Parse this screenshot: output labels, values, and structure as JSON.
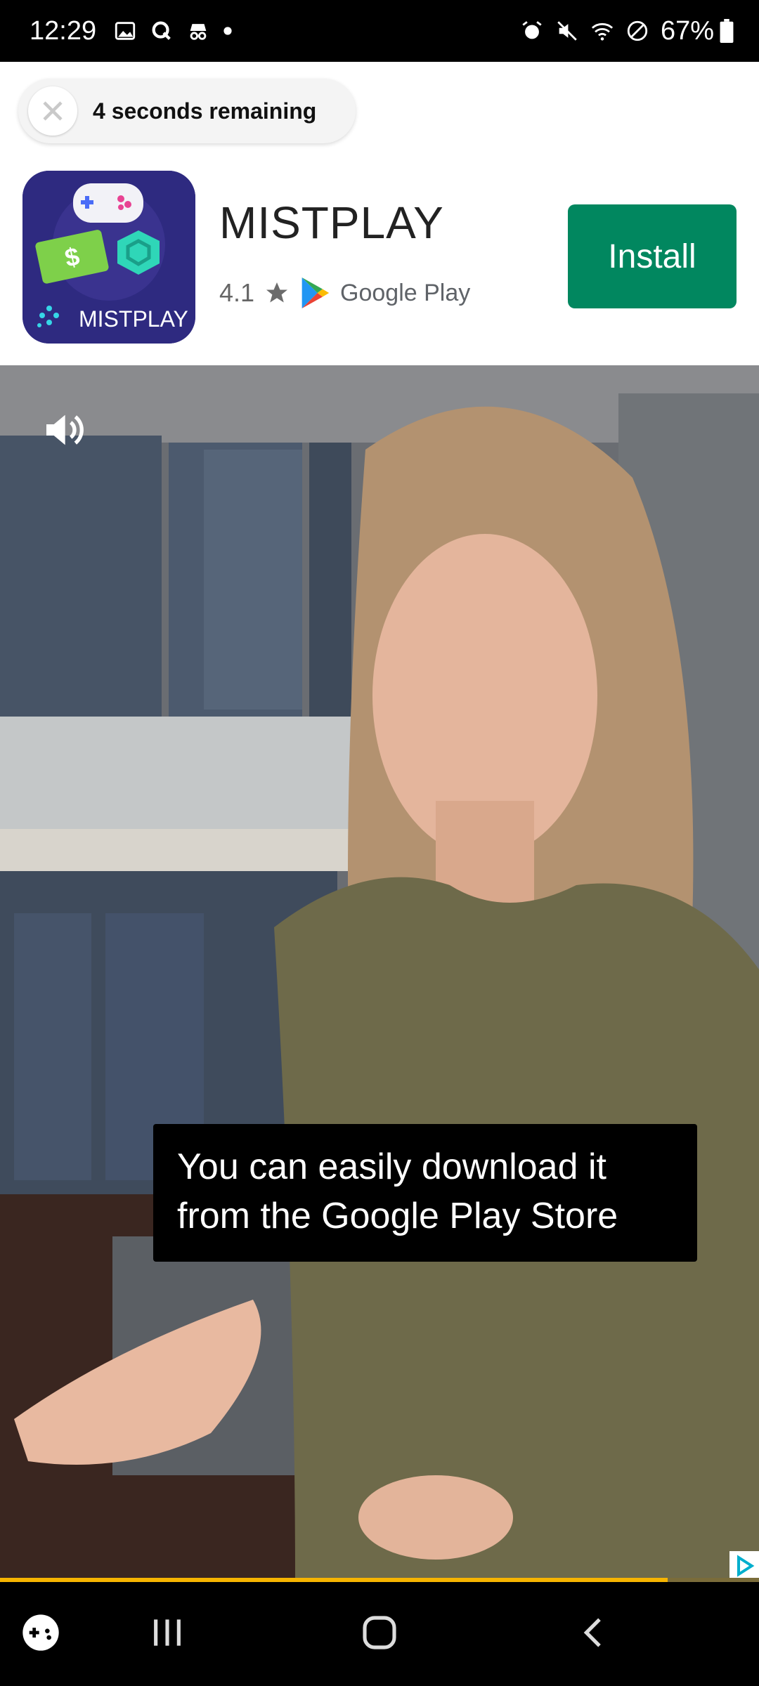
{
  "status_bar": {
    "time": "12:29",
    "battery": "67%",
    "left_icons": [
      "gallery-icon",
      "q-app-icon",
      "incognito-icon",
      "dot-icon"
    ],
    "right_icons": [
      "alarm-icon",
      "mute-icon",
      "wifi-icon",
      "dnd-icon",
      "battery-icon"
    ]
  },
  "ad": {
    "timer_text": "4 seconds remaining",
    "app_icon_label": "MISTPLAY",
    "app_name": "MISTPLAY",
    "rating": "4.1",
    "store_label": "Google Play",
    "install_label": "Install",
    "accent_color": "#01875f"
  },
  "video": {
    "caption": "You can easily download it from the Google Play Store",
    "progress": 0.88
  },
  "nav_bar": {
    "items": [
      "game-launcher-icon",
      "recents-icon",
      "home-icon",
      "back-icon"
    ]
  }
}
